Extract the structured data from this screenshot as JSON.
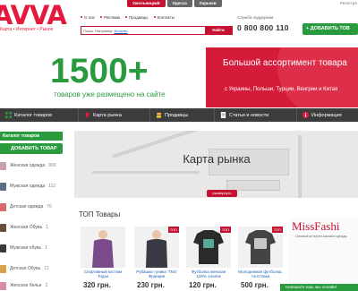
{
  "header": {
    "logo_text": "AVVA",
    "logo_tagline": "Карта • Интернет • Рынок",
    "city_tabs": [
      "Хмельницкий",
      "Одесса",
      "Харьков"
    ],
    "top_nav": [
      "О нас",
      "Реклама",
      "Продавцы",
      "Контакты"
    ],
    "search_placeholder": "Поиск. Например:",
    "search_example": "Ботинки",
    "search_button": "Найти",
    "support_label": "Служба поддержки",
    "phone": "0 800 800 110",
    "login_link": "Регистра",
    "add_goods_button": "ДОБАВИТЬ ТОВ"
  },
  "banner": {
    "big_number": "1500+",
    "big_sub": "товаров уже размещено на сайте",
    "right_title": "Большой ассортимент товара",
    "right_sub": "с Украины, Польши, Турции, Венгрии и Китая"
  },
  "main_nav": [
    "Каталог товаров",
    "Карта рынка",
    "Продавцы",
    "Статьи и новости",
    "Информация"
  ],
  "sidebar": {
    "header": "Каталог товаров",
    "add_button": "ДОБАВИТЬ ТОВАР",
    "categories": [
      {
        "label": "Женская одежда",
        "count": "900"
      },
      {
        "label": "Мужская одежда",
        "count": "112"
      },
      {
        "label": "Детская одежда",
        "count": "70"
      },
      {
        "label": "Женская Обувь",
        "count": "1"
      },
      {
        "label": "Мужская обувь",
        "count": "1"
      },
      {
        "label": "Детская Обувь",
        "count": "11"
      },
      {
        "label": "Женское белье",
        "count": "2"
      }
    ]
  },
  "map": {
    "title": "Карта рынка",
    "expand": "развернуть"
  },
  "top_products": {
    "title": "ТОП Товары",
    "badge": "ТОП",
    "items": [
      {
        "name": "Спортивный костюм Тодзи",
        "price": "320 грн."
      },
      {
        "name": "Рубашка туника 'TNS' Франция",
        "price": "230 грн."
      },
      {
        "name": "Футболка женская 100% хлопок",
        "price": "120 грн."
      },
      {
        "name": "Молодежная футболка, толстовка",
        "price": "500 грн."
      }
    ]
  },
  "promo": {
    "title": "MissFashi",
    "sub": "Оптовый интернет-магазин одежды"
  },
  "chat": "Напишите нам, мы онлайн!"
}
